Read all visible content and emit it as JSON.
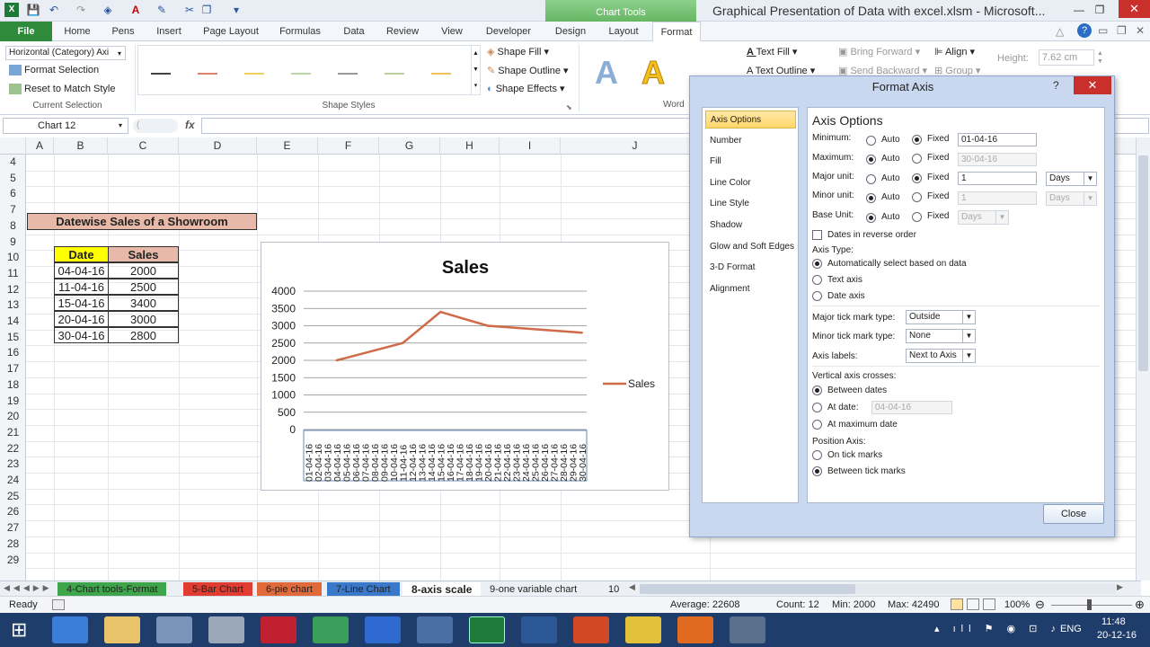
{
  "window": {
    "doc_title": "Graphical Presentation of Data with excel.xlsm - Microsoft...",
    "context_band": "Chart Tools"
  },
  "ribbon_tabs": [
    "File",
    "Home",
    "Pens",
    "Insert",
    "Page Layout",
    "Formulas",
    "Data",
    "Review",
    "View",
    "Developer",
    "Design",
    "Layout",
    "Format"
  ],
  "ribbon": {
    "current_selection": {
      "element": "Horizontal (Category) Axi",
      "format_selection": "Format Selection",
      "reset": "Reset to Match Style",
      "group_label": "Current Selection"
    },
    "shape_styles": {
      "fill": "Shape Fill",
      "outline": "Shape Outline",
      "effects": "Shape Effects",
      "group_label": "Shape Styles"
    },
    "wordart_label": "Word",
    "wordart_glyph": "A",
    "text_fill": "Text Fill",
    "text_outline": "Text Outline",
    "bring_forward": "Bring Forward",
    "send_backward": "Send Backward",
    "align": "Align",
    "group": "Group",
    "height_label": "Height:",
    "height_value": "7.62 cm"
  },
  "formula_bar": {
    "name_box": "Chart 12",
    "fx": "fx",
    "formula": ""
  },
  "columns": [
    "A",
    "B",
    "C",
    "D",
    "E",
    "F",
    "G",
    "H",
    "I",
    "J"
  ],
  "rows": [
    "4",
    "5",
    "6",
    "7",
    "8",
    "9",
    "10",
    "11",
    "12",
    "13",
    "14",
    "15",
    "16",
    "17",
    "18",
    "19",
    "20",
    "21",
    "22",
    "23",
    "24",
    "25",
    "26",
    "27",
    "28",
    "29"
  ],
  "sheet": {
    "title": "Datewise Sales of a Showroom",
    "table_headers": [
      "Date",
      "Sales"
    ],
    "table_rows": [
      [
        "04-04-16",
        "2000"
      ],
      [
        "11-04-16",
        "2500"
      ],
      [
        "15-04-16",
        "3400"
      ],
      [
        "20-04-16",
        "3000"
      ],
      [
        "30-04-16",
        "2800"
      ]
    ]
  },
  "chart_data": {
    "type": "line",
    "title": "Sales",
    "xlabel": "",
    "ylabel": "",
    "ylim": [
      0,
      4000
    ],
    "yticks": [
      "0",
      "500",
      "1000",
      "1500",
      "2000",
      "2500",
      "3000",
      "3500",
      "4000"
    ],
    "x_ticks": [
      "01-04-16",
      "02-04-16",
      "03-04-16",
      "04-04-16",
      "05-04-16",
      "06-04-16",
      "07-04-16",
      "08-04-16",
      "09-04-16",
      "10-04-16",
      "11-04-16",
      "12-04-16",
      "13-04-16",
      "14-04-16",
      "15-04-16",
      "16-04-16",
      "17-04-16",
      "18-04-16",
      "19-04-16",
      "20-04-16",
      "21-04-16",
      "22-04-16",
      "23-04-16",
      "24-04-16",
      "25-04-16",
      "26-04-16",
      "27-04-16",
      "28-04-16",
      "29-04-16",
      "30-04-16"
    ],
    "series": [
      {
        "name": "Sales",
        "color": "#d06a48",
        "x": [
          "04-04-16",
          "11-04-16",
          "15-04-16",
          "20-04-16",
          "30-04-16"
        ],
        "values": [
          2000,
          2500,
          3400,
          3000,
          2800
        ]
      }
    ],
    "legend": "right",
    "grid": true
  },
  "sheet_tabs": [
    "4-Chart tools-Format",
    "5-Bar Chart",
    "6-pie chart",
    "7-Line Chart",
    "8-axis scale",
    "9-one variable chart",
    "10"
  ],
  "sheet_tab_colors": [
    "#3ea54a",
    "#e03c31",
    "#e06a3a",
    "#3a78c9",
    "",
    "",
    ""
  ],
  "status": {
    "ready": "Ready",
    "average": "Average: 22608",
    "count": "Count: 12",
    "min": "Min: 2000",
    "max": "Max: 42490",
    "zoom": "100%"
  },
  "taskbar": {
    "lang": "ENG",
    "time": "11:48",
    "date": "20-12-16"
  },
  "dialog": {
    "title": "Format Axis",
    "help": "?",
    "nav": [
      "Axis Options",
      "Number",
      "Fill",
      "Line Color",
      "Line Style",
      "Shadow",
      "Glow and Soft Edges",
      "3-D Format",
      "Alignment"
    ],
    "heading": "Axis Options",
    "minimum": "Minimum:",
    "maximum": "Maximum:",
    "major_unit": "Major unit:",
    "minor_unit": "Minor unit:",
    "base_unit": "Base Unit:",
    "auto": "Auto",
    "fixed": "Fixed",
    "min_value": "01-04-16",
    "max_value": "30-04-16",
    "major_value": "1",
    "minor_value": "1",
    "days": "Days",
    "reverse": "Dates in reverse order",
    "axis_type": "Axis Type:",
    "auto_select": "Automatically select based on data",
    "text_axis": "Text axis",
    "date_axis": "Date axis",
    "major_tick": "Major tick mark type:",
    "major_tick_val": "Outside",
    "minor_tick": "Minor tick mark type:",
    "minor_tick_val": "None",
    "axis_labels": "Axis labels:",
    "axis_labels_val": "Next to Axis",
    "vertical_crosses": "Vertical axis crosses:",
    "between_dates": "Between dates",
    "at_date": "At date:",
    "at_date_val": "04-04-16",
    "at_max_date": "At maximum date",
    "position_axis": "Position Axis:",
    "on_tick": "On tick marks",
    "between_tick": "Between tick marks",
    "close": "Close"
  }
}
